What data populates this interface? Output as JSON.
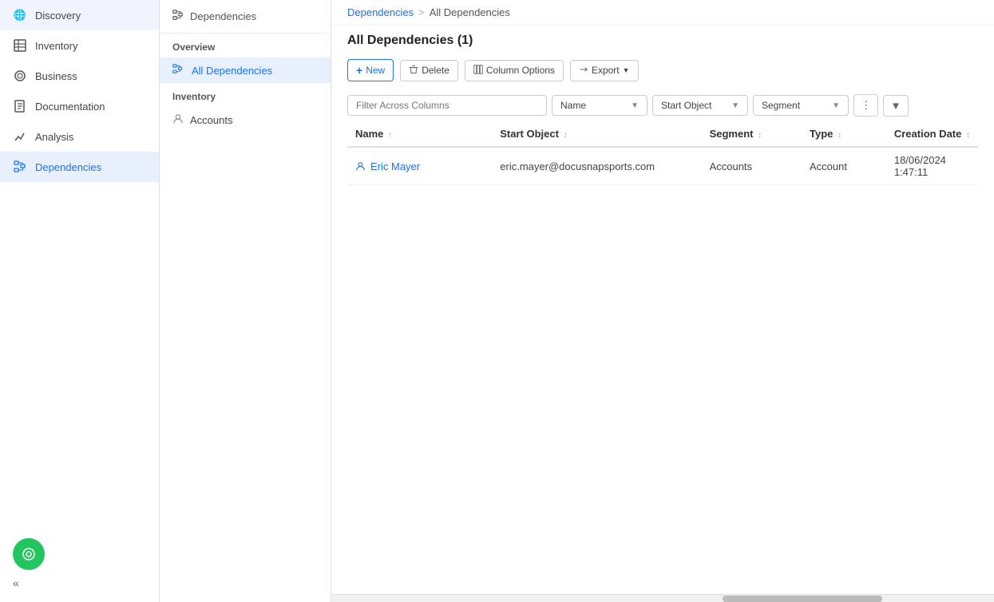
{
  "nav": {
    "items": [
      {
        "id": "discovery",
        "label": "Discovery",
        "icon": "🌐"
      },
      {
        "id": "inventory",
        "label": "Inventory",
        "icon": "📦"
      },
      {
        "id": "business",
        "label": "Business",
        "icon": "⚙️"
      },
      {
        "id": "documentation",
        "label": "Documentation",
        "icon": "📄"
      },
      {
        "id": "analysis",
        "label": "Analysis",
        "icon": "📈"
      },
      {
        "id": "dependencies",
        "label": "Dependencies",
        "icon": "⚡",
        "active": true
      }
    ],
    "collapse_label": "«",
    "fab_icon": "⚡"
  },
  "breadcrumb": {
    "parent": "Dependencies",
    "separator": ">",
    "current": "All Dependencies"
  },
  "middle": {
    "header_label": "Dependencies",
    "header_icon": "⚡",
    "overview_label": "Overview",
    "items": [
      {
        "id": "all-dependencies",
        "label": "All Dependencies",
        "active": true
      }
    ],
    "inventory_label": "Inventory",
    "accounts_item": "Accounts",
    "accounts_icon": "👤"
  },
  "content": {
    "title": "All Dependencies (1)",
    "toolbar": {
      "new_label": "New",
      "delete_label": "Delete",
      "column_options_label": "Column Options",
      "export_label": "Export"
    },
    "filter": {
      "placeholder": "Filter Across Columns",
      "name_dropdown": "Name",
      "start_object_dropdown": "Start Object",
      "segment_dropdown": "Segment"
    },
    "table": {
      "columns": [
        {
          "id": "name",
          "label": "Name",
          "sort": "↑"
        },
        {
          "id": "start_object",
          "label": "Start Object",
          "sort": "↕"
        },
        {
          "id": "segment",
          "label": "Segment",
          "sort": "↕"
        },
        {
          "id": "type",
          "label": "Type",
          "sort": "↕"
        },
        {
          "id": "creation_date",
          "label": "Creation Date",
          "sort": "↕"
        }
      ],
      "rows": [
        {
          "name": "Eric Mayer",
          "start_object": "eric.mayer@docusnapsports.com",
          "segment": "Accounts",
          "type": "Account",
          "creation_date": "18/06/2024 1:47:11"
        }
      ]
    }
  }
}
